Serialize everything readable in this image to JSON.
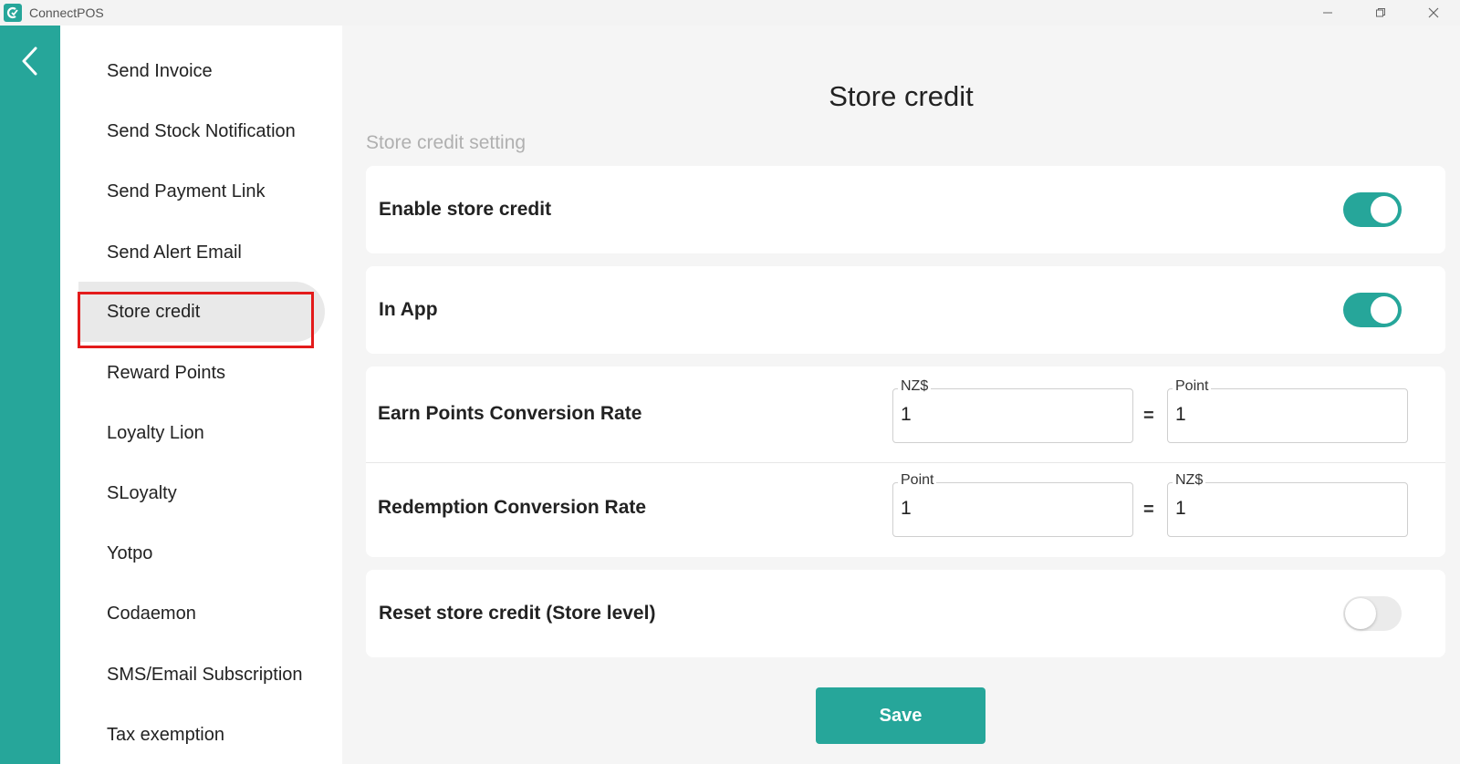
{
  "window": {
    "title": "ConnectPOS",
    "icon_name": "connectpos-logo-icon",
    "controls": [
      "minimize-icon",
      "restore-icon",
      "close-icon"
    ]
  },
  "colors": {
    "accent": "#26a69a",
    "highlight_border": "#e31b1b"
  },
  "sidebar": {
    "back_icon": "chevron-left-icon",
    "items": [
      {
        "label": "Send Invoice"
      },
      {
        "label": "Send Stock Notification"
      },
      {
        "label": "Send Payment Link"
      },
      {
        "label": "Send Alert Email"
      },
      {
        "label": "Store credit",
        "active": true
      },
      {
        "label": "Reward Points"
      },
      {
        "label": "Loyalty Lion"
      },
      {
        "label": "SLoyalty"
      },
      {
        "label": "Yotpo"
      },
      {
        "label": "Codaemon"
      },
      {
        "label": "SMS/Email Subscription"
      },
      {
        "label": "Tax exemption"
      }
    ]
  },
  "main": {
    "title": "Store credit",
    "section_label": "Store credit setting",
    "enable_store_credit": {
      "label": "Enable store credit",
      "enabled": true
    },
    "in_app": {
      "label": "In App",
      "enabled": true
    },
    "earn_rate": {
      "label": "Earn Points Conversion Rate",
      "left": {
        "label": "NZ$",
        "value": "1"
      },
      "equals": "=",
      "right": {
        "label": "Point",
        "value": "1"
      }
    },
    "redemption_rate": {
      "label": "Redemption Conversion Rate",
      "left": {
        "label": "Point",
        "value": "1"
      },
      "equals": "=",
      "right": {
        "label": "NZ$",
        "value": "1"
      }
    },
    "reset_store_credit": {
      "label": "Reset store credit (Store level)",
      "enabled": false
    },
    "save_label": "Save"
  }
}
